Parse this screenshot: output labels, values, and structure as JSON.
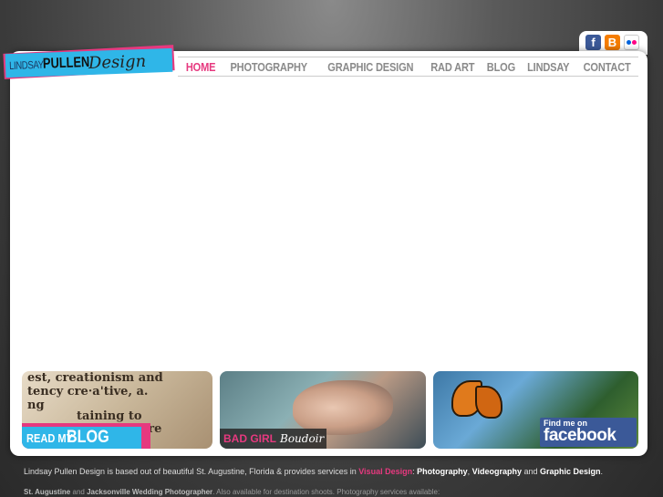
{
  "logo": {
    "part1": "LINDSAY",
    "part2": "PULLEN",
    "part3": "Design"
  },
  "nav": {
    "items": [
      {
        "label": "HOME",
        "active": true
      },
      {
        "label": "PHOTOGRAPHY"
      },
      {
        "label": "GRAPHIC DESIGN"
      },
      {
        "label": "RAD ART"
      },
      {
        "label": "BLOG"
      },
      {
        "label": "LINDSAY"
      },
      {
        "label": "CONTACT"
      }
    ]
  },
  "social": {
    "facebook": "f",
    "blogger": "B"
  },
  "tiles": {
    "blog": {
      "dict_lines": [
        "est,  creationism and",
        "tency  cre·a'tive, a.",
        "  ng",
        "   taining  to",
        "       ly, cre"
      ],
      "label_a": "READ MY",
      "label_b": "BLOG"
    },
    "boudoir": {
      "label_a": "BAD GIRL",
      "label_b": "Boudoir"
    },
    "facebook": {
      "label_a": "Find me on",
      "label_b": "facebook"
    }
  },
  "footer": {
    "line1_a": "Lindsay Pullen Design is based out of beautiful St. Augustine, Florida & provides services in ",
    "line1_b": "Visual Design",
    "line1_c": ": ",
    "line1_d": "Photography",
    "line1_e": ", ",
    "line1_f": "Videography",
    "line1_g": " and ",
    "line1_h": "Graphic Design",
    "line1_i": ".",
    "line2_a": "St. Augustine",
    "line2_b": " and ",
    "line2_c": "Jacksonville Wedding Photographer",
    "line2_d": ". Also available for destination shoots. Photography services available:"
  }
}
